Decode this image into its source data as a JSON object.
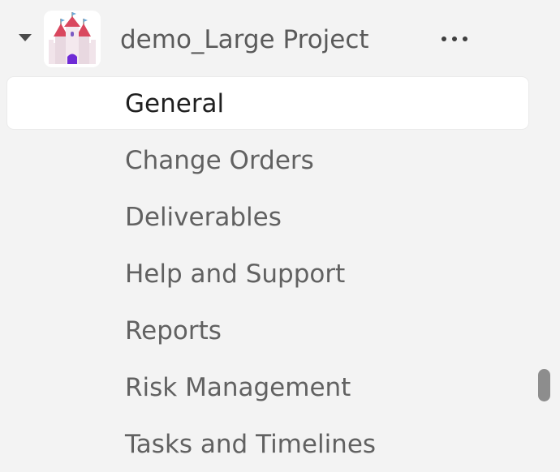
{
  "project": {
    "name": "demo_Large Project",
    "icon": "castle-icon",
    "expanded": true
  },
  "nav": {
    "items": [
      {
        "label": "General",
        "selected": true
      },
      {
        "label": "Change Orders",
        "selected": false
      },
      {
        "label": "Deliverables",
        "selected": false
      },
      {
        "label": "Help and Support",
        "selected": false
      },
      {
        "label": "Reports",
        "selected": false
      },
      {
        "label": "Risk Management",
        "selected": false
      },
      {
        "label": "Tasks and Timelines",
        "selected": false
      }
    ]
  },
  "colors": {
    "background": "#f3f3f3",
    "selected_background": "#ffffff",
    "text": "#616161",
    "selected_text": "#1f1f1f"
  }
}
